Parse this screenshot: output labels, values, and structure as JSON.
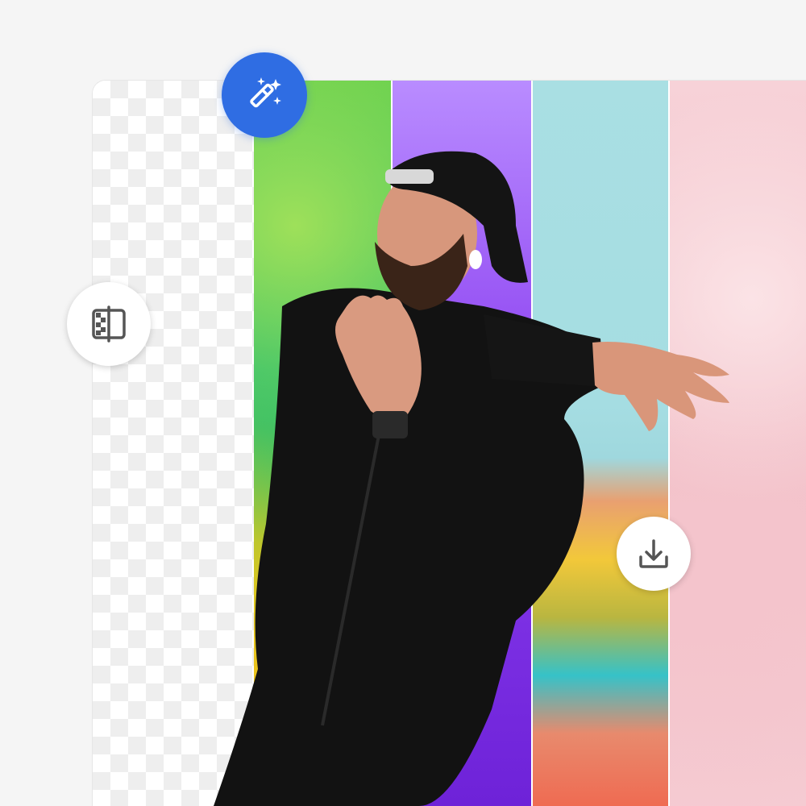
{
  "tools": {
    "magic": {
      "icon": "magic-wand-icon",
      "color": "#2f6de3"
    },
    "compare": {
      "icon": "split-compare-icon"
    },
    "download": {
      "icon": "download-icon"
    }
  },
  "backgrounds": [
    {
      "name": "transparent",
      "pattern": "checkerboard"
    },
    {
      "name": "green-paint-splash",
      "color": "#4cc55a"
    },
    {
      "name": "purple-gradient",
      "color": "#8b3ff0"
    },
    {
      "name": "graffiti-wall",
      "color": "#a5dde2"
    },
    {
      "name": "pink-marble",
      "color": "#f4c8cf"
    }
  ]
}
